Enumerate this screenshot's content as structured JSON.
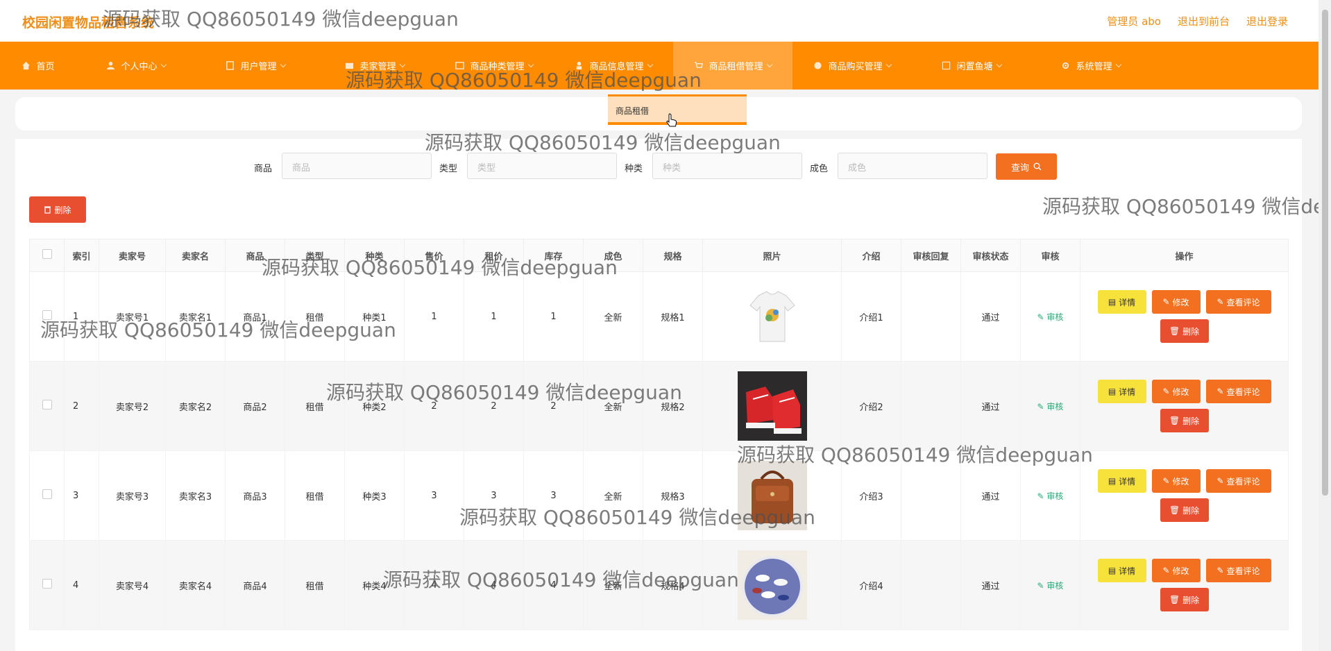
{
  "header": {
    "brand": "校园闲置物品租售系统",
    "admin": "管理员 abo",
    "to_front": "退出到前台",
    "logout": "退出登录"
  },
  "nav": {
    "items": [
      {
        "label": "首页"
      },
      {
        "label": "个人中心"
      },
      {
        "label": "用户管理"
      },
      {
        "label": "卖家管理"
      },
      {
        "label": "商品种类管理"
      },
      {
        "label": "商品信息管理"
      },
      {
        "label": "商品租借管理"
      },
      {
        "label": "商品购买管理"
      },
      {
        "label": "闲置鱼塘"
      },
      {
        "label": "系统管理"
      }
    ],
    "dropdown_item": "商品租借"
  },
  "search": {
    "goods_label": "商品",
    "goods_placeholder": "商品",
    "type_label": "类型",
    "type_placeholder": "类型",
    "kind_label": "种类",
    "kind_placeholder": "种类",
    "condition_label": "成色",
    "condition_placeholder": "成色",
    "query_button": "查询"
  },
  "toolbar": {
    "delete_button": "删除"
  },
  "table": {
    "headers": [
      "索引",
      "卖家号",
      "卖家名",
      "商品",
      "类型",
      "种类",
      "售价",
      "租价",
      "库存",
      "成色",
      "规格",
      "照片",
      "介绍",
      "审核回复",
      "审核状态",
      "审核",
      "操作"
    ],
    "rows": [
      {
        "index": "1",
        "seller_no": "卖家号1",
        "seller_name": "卖家名1",
        "goods": "商品1",
        "type": "租借",
        "kind": "种类1",
        "price": "1",
        "rent": "1",
        "stock": "1",
        "condition": "全新",
        "spec": "规格1",
        "intro": "介绍1",
        "reply": "",
        "status": "通过",
        "review": "审核",
        "photo": "white-tshirt"
      },
      {
        "index": "2",
        "seller_no": "卖家号2",
        "seller_name": "卖家名2",
        "goods": "商品2",
        "type": "租借",
        "kind": "种类2",
        "price": "2",
        "rent": "2",
        "stock": "2",
        "condition": "全新",
        "spec": "规格2",
        "intro": "介绍2",
        "reply": "",
        "status": "通过",
        "review": "审核",
        "photo": "red-sneakers"
      },
      {
        "index": "3",
        "seller_no": "卖家号3",
        "seller_name": "卖家名3",
        "goods": "商品3",
        "type": "租借",
        "kind": "种类3",
        "price": "3",
        "rent": "3",
        "stock": "3",
        "condition": "全新",
        "spec": "规格3",
        "intro": "介绍3",
        "reply": "",
        "status": "通过",
        "review": "审核",
        "photo": "brown-bag"
      },
      {
        "index": "4",
        "seller_no": "卖家号4",
        "seller_name": "卖家名4",
        "goods": "商品4",
        "type": "租借",
        "kind": "种类4",
        "price": "4",
        "rent": "4",
        "stock": "4",
        "condition": "全新",
        "spec": "规格4",
        "intro": "介绍4",
        "reply": "",
        "status": "通过",
        "review": "审核",
        "photo": "candy-bowl"
      }
    ],
    "actions": {
      "detail": "详情",
      "edit": "修改",
      "comment": "查看评论",
      "delete": "删除"
    }
  },
  "watermark": "源码获取 QQ86050149 微信deepguan",
  "colors": {
    "accent": "#ff8c00",
    "brand_text": "#ef8f1a",
    "danger": "#e84e30",
    "warning": "#f7e23b",
    "success": "#2aa876"
  }
}
